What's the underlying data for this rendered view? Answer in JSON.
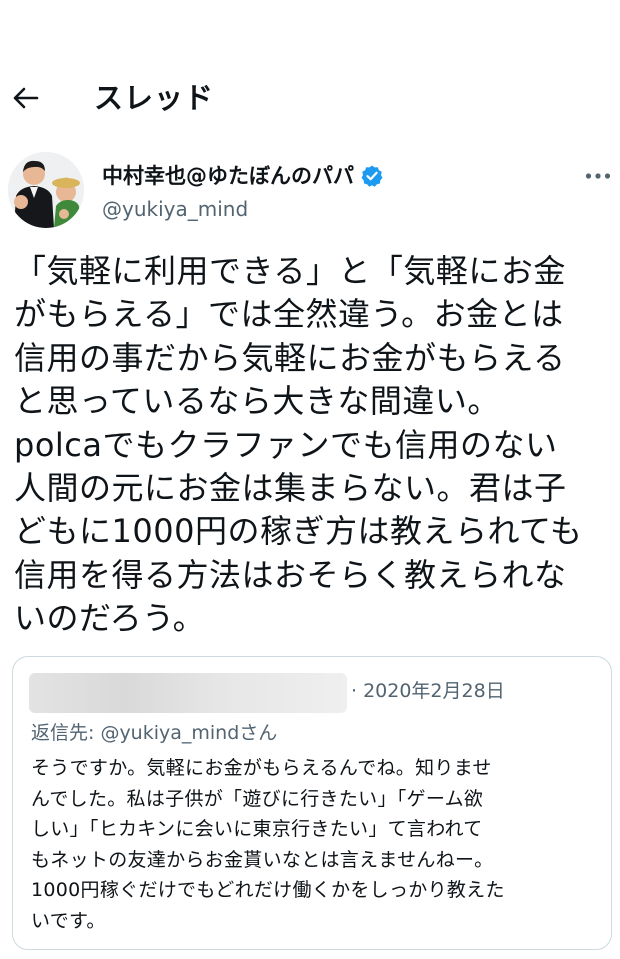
{
  "header": {
    "back_icon": "arrow-left-icon",
    "title": "スレッド"
  },
  "author": {
    "display_name": "中村幸也@ゆたぼんのパパ",
    "handle": "@yukiya_mind",
    "verified_icon": "verified-badge-icon",
    "verified_color": "#1d9bf0",
    "more_icon": "more-horizontal-icon"
  },
  "tweet": {
    "lines": [
      "「気軽に利用できる」と「気軽にお金",
      "がもらえる」では全然違う。お金とは",
      "信用の事だから気軽にお金がもらえる",
      "と思っているなら大きな間違い。",
      "polcaでもクラファンでも信用のない",
      "人間の元にお金は集まらない。君は子",
      "どもに1000円の稼ぎ方は教えられても",
      "信用を得る方法はおそらく教えられな",
      "いのだろう。"
    ]
  },
  "quote": {
    "date": "· 2020年2月28日",
    "reply_to": "返信先: @yukiya_mindさん",
    "lines": [
      "そうですか。気軽にお金がもらえるんでね。知りませ",
      "んでした。私は子供が「遊びに行きたい」「ゲーム欲",
      "しい」「ヒカキンに会いに東京行きたい」て言われて",
      "もネットの友達からお金貰いなとは言えませんねー。",
      "1000円稼ぐだけでもどれだけ働くかをしっかり教えた",
      "いです。"
    ]
  },
  "colors": {
    "text_primary": "#0f1419",
    "text_secondary": "#536471",
    "border": "#cfd9de",
    "accent": "#1d9bf0"
  }
}
